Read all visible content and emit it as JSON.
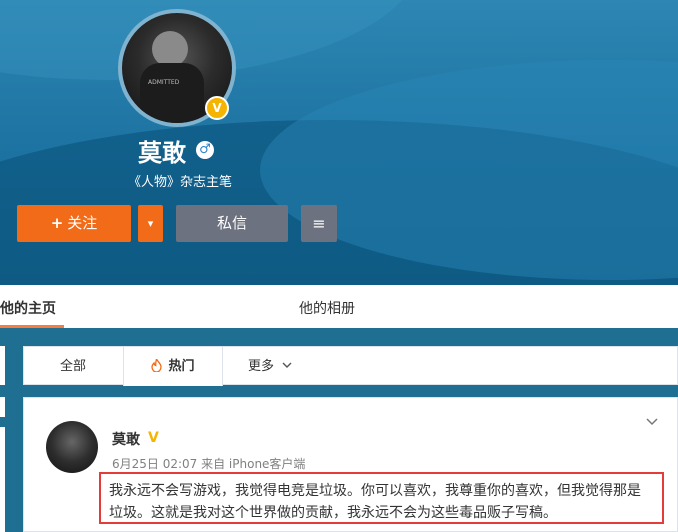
{
  "profile": {
    "name": "莫敢",
    "gender_symbol": "♂",
    "verified_mark": "V",
    "subtitle": "《人物》杂志主笔",
    "avatar_shirt_text": "ADMITTED"
  },
  "actions": {
    "follow_label": "关注",
    "follow_plus": "+",
    "message_label": "私信",
    "more_icon": "≡",
    "dropdown_icon": "▾"
  },
  "tabs": {
    "home": "他的主页",
    "album": "他的相册"
  },
  "filter": {
    "all": "全部",
    "hot": "热门",
    "more": "更多"
  },
  "post": {
    "author": "莫敢",
    "verified": "V",
    "time_source": "6月25日 02:07 来自 iPhone客户端",
    "text": "我永远不会写游戏，我觉得电竞是垃圾。你可以喜欢，我尊重你的喜欢，但我觉得那是垃圾。这就是我对这个世界做的贡献，我永远不会为这些毒品贩子写稿。"
  },
  "colors": {
    "accent_orange": "#f26b18",
    "verified_gold": "#f5b400",
    "highlight_red": "#e53b3b",
    "cover_blue": "#1c72a0"
  }
}
